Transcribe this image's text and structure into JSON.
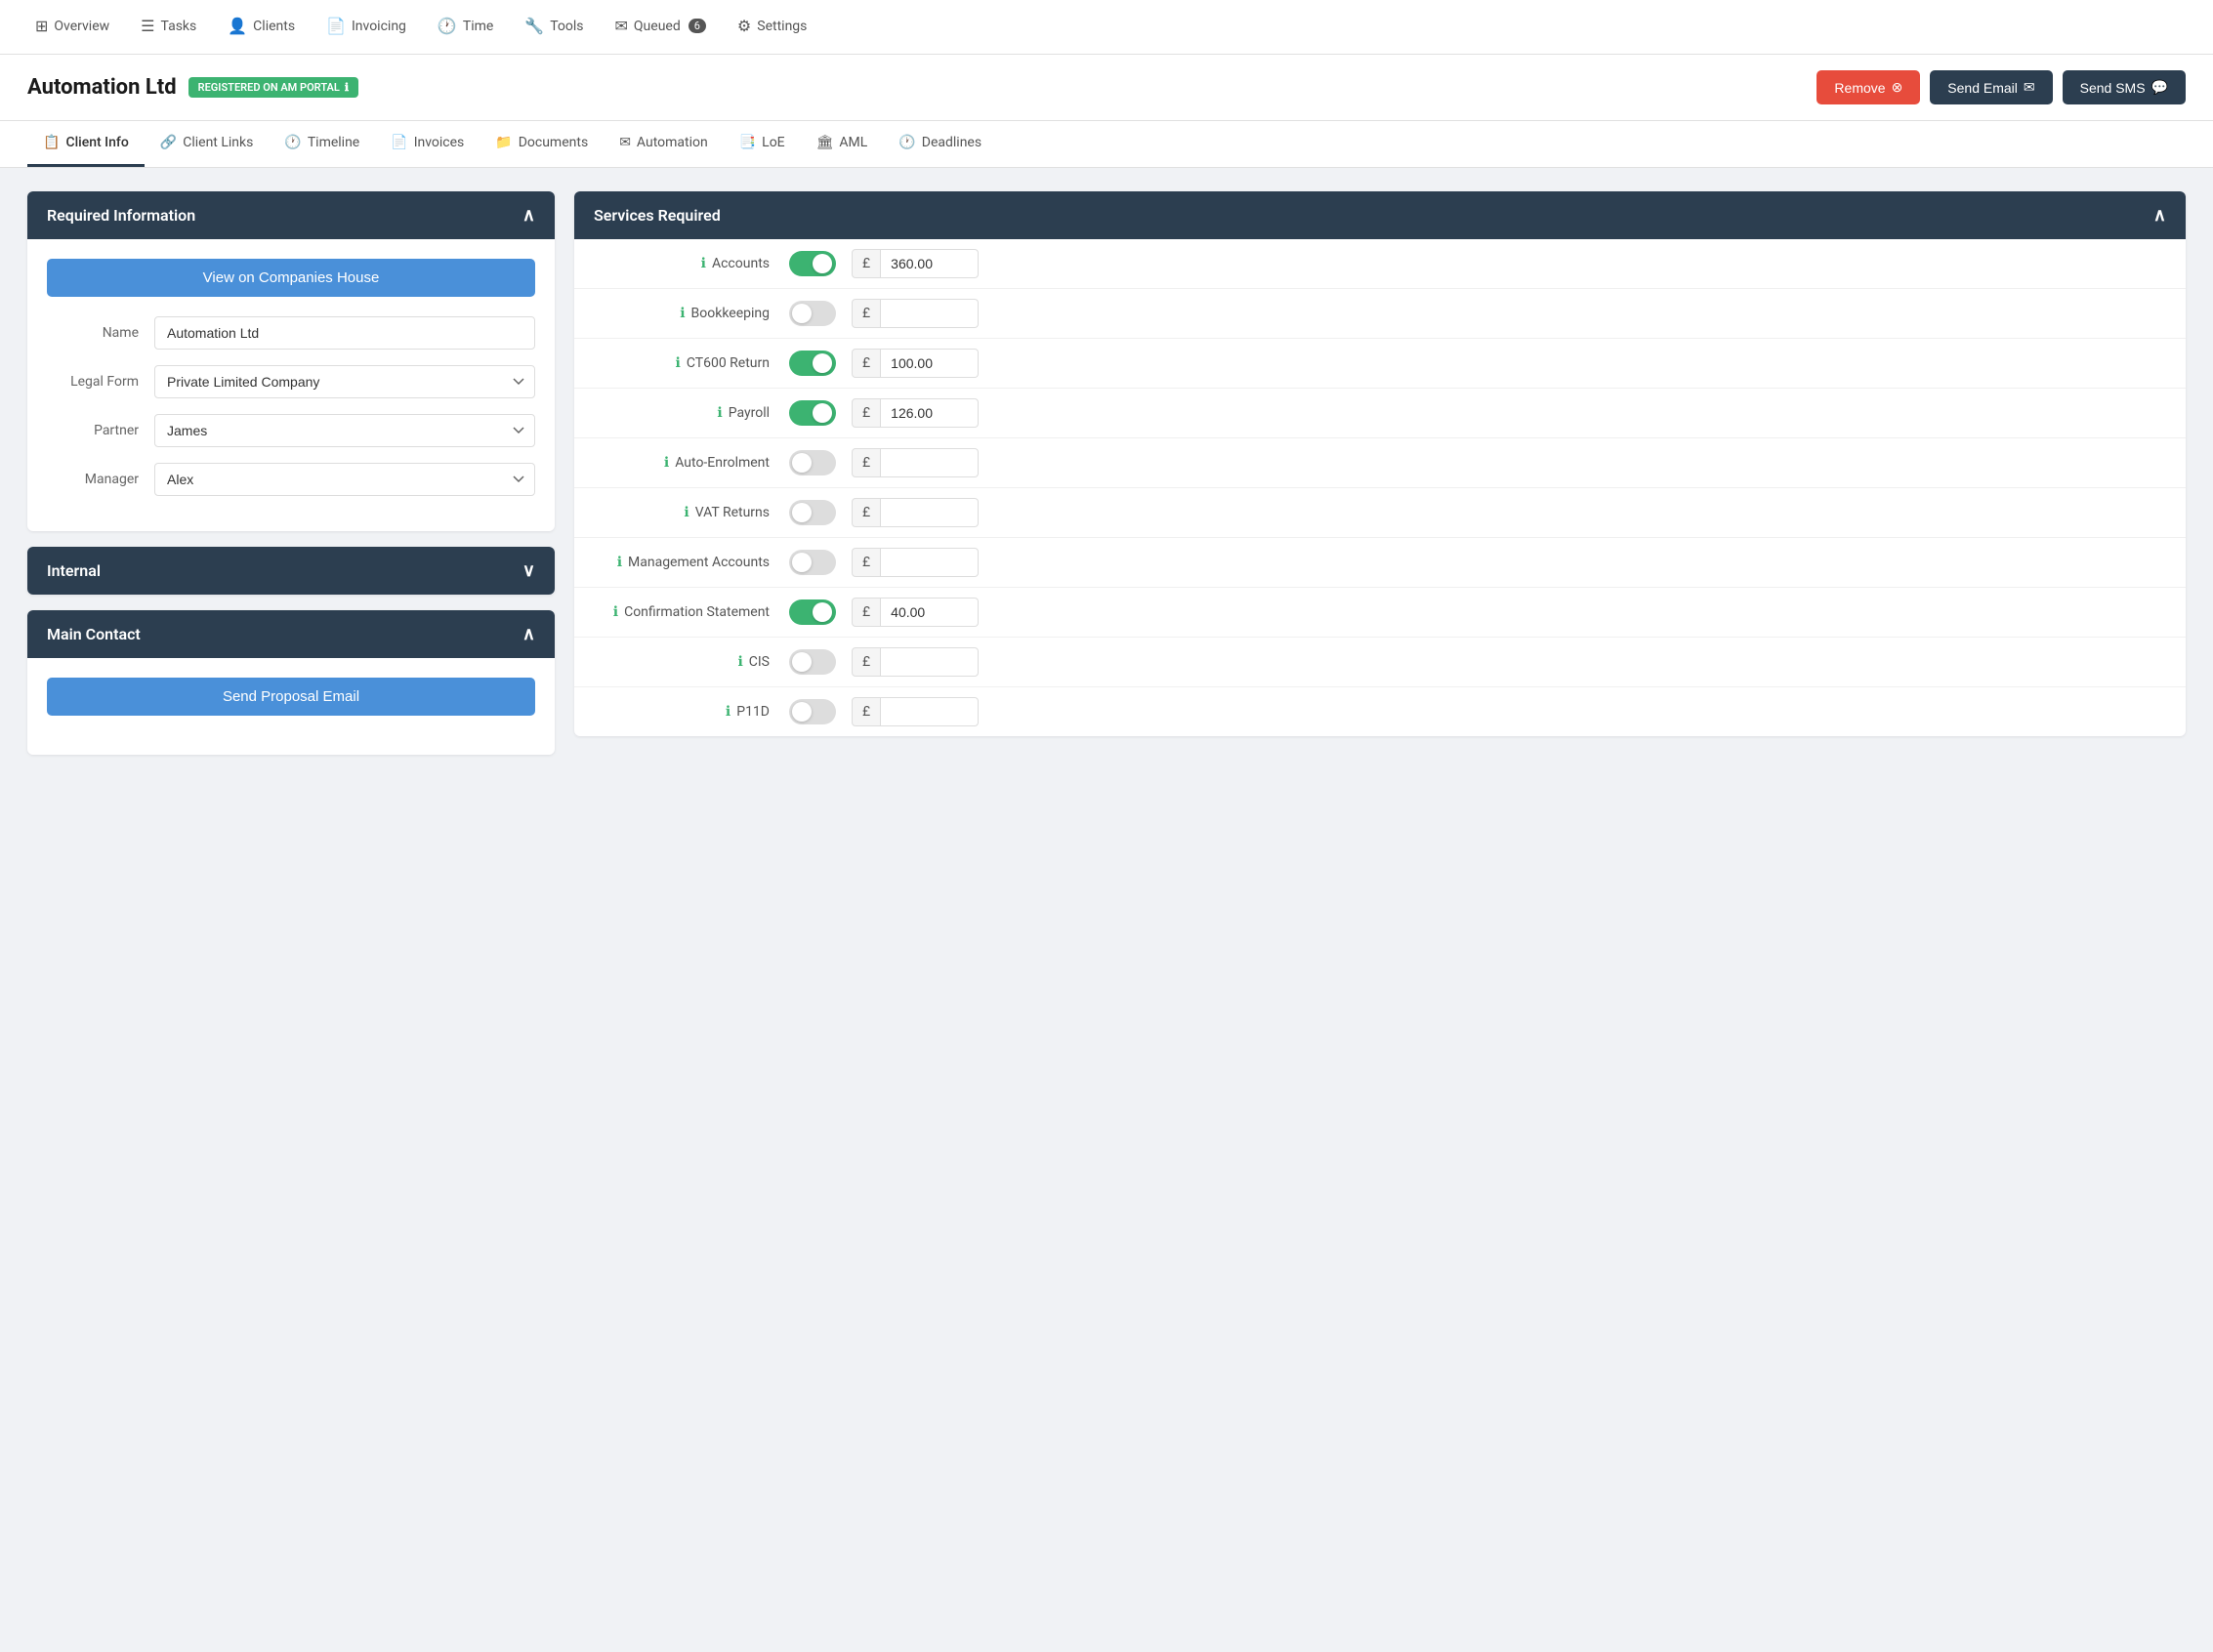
{
  "nav": {
    "items": [
      {
        "id": "overview",
        "label": "Overview",
        "icon": "⊞"
      },
      {
        "id": "tasks",
        "label": "Tasks",
        "icon": "☰"
      },
      {
        "id": "clients",
        "label": "Clients",
        "icon": "👤"
      },
      {
        "id": "invoicing",
        "label": "Invoicing",
        "icon": "📄"
      },
      {
        "id": "time",
        "label": "Time",
        "icon": "🕐"
      },
      {
        "id": "tools",
        "label": "Tools",
        "icon": "🔧"
      },
      {
        "id": "queued",
        "label": "Queued",
        "icon": "✉",
        "badge": "6"
      },
      {
        "id": "settings",
        "label": "Settings",
        "icon": "⚙"
      }
    ]
  },
  "header": {
    "title": "Automation Ltd",
    "badge": "REGISTERED ON AM PORTAL",
    "badge_icon": "ℹ",
    "actions": {
      "remove": "Remove",
      "send_email": "Send Email",
      "send_sms": "Send SMS"
    }
  },
  "tabs": [
    {
      "id": "client-info",
      "label": "Client Info",
      "icon": "📋",
      "active": true
    },
    {
      "id": "client-links",
      "label": "Client Links",
      "icon": "🔗"
    },
    {
      "id": "timeline",
      "label": "Timeline",
      "icon": "🕐"
    },
    {
      "id": "invoices",
      "label": "Invoices",
      "icon": "📄"
    },
    {
      "id": "documents",
      "label": "Documents",
      "icon": "📁"
    },
    {
      "id": "automation",
      "label": "Automation",
      "icon": "✉"
    },
    {
      "id": "loe",
      "label": "LoE",
      "icon": "📑"
    },
    {
      "id": "aml",
      "label": "AML",
      "icon": "🏛"
    },
    {
      "id": "deadlines",
      "label": "Deadlines",
      "icon": "🕐"
    }
  ],
  "required_info": {
    "title": "Required Information",
    "view_btn": "View on Companies House",
    "fields": {
      "name_label": "Name",
      "name_value": "Automation Ltd",
      "legal_form_label": "Legal Form",
      "legal_form_value": "Private Limited Company",
      "partner_label": "Partner",
      "partner_value": "James",
      "manager_label": "Manager",
      "manager_value": "Alex"
    }
  },
  "internal": {
    "title": "Internal"
  },
  "main_contact": {
    "title": "Main Contact",
    "send_proposal_btn": "Send Proposal Email"
  },
  "services": {
    "title": "Services Required",
    "items": [
      {
        "id": "accounts",
        "label": "Accounts",
        "enabled": true,
        "price": "360.00"
      },
      {
        "id": "bookkeeping",
        "label": "Bookkeeping",
        "enabled": false,
        "price": ""
      },
      {
        "id": "ct600",
        "label": "CT600 Return",
        "enabled": true,
        "price": "100.00"
      },
      {
        "id": "payroll",
        "label": "Payroll",
        "enabled": true,
        "price": "126.00"
      },
      {
        "id": "auto-enrolment",
        "label": "Auto-Enrolment",
        "enabled": false,
        "price": ""
      },
      {
        "id": "vat-returns",
        "label": "VAT Returns",
        "enabled": false,
        "price": ""
      },
      {
        "id": "management-accounts",
        "label": "Management Accounts",
        "enabled": false,
        "price": ""
      },
      {
        "id": "confirmation-statement",
        "label": "Confirmation Statement",
        "enabled": true,
        "price": "40.00"
      },
      {
        "id": "cis",
        "label": "CIS",
        "enabled": false,
        "price": ""
      },
      {
        "id": "p11d",
        "label": "P11D",
        "enabled": false,
        "price": ""
      }
    ],
    "currency_symbol": "£"
  }
}
